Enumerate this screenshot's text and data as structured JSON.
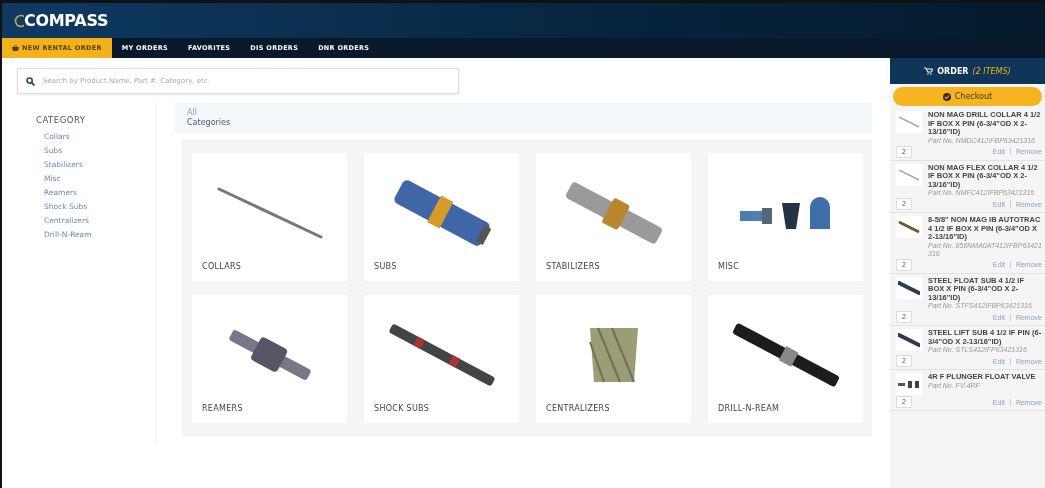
{
  "header": {
    "logo": "COMPASS"
  },
  "nav": [
    {
      "label": "NEW RENTAL ORDER",
      "selected": true
    },
    {
      "label": "MY ORDERS",
      "selected": false
    },
    {
      "label": "FAVORITES",
      "selected": false
    },
    {
      "label": "DIS ORDERS",
      "selected": false
    },
    {
      "label": "DNR ORDERS",
      "selected": false
    }
  ],
  "search": {
    "placeholder": "Search by Product Name, Part #, Category, etc."
  },
  "sidebar": {
    "title": "CATEGORY",
    "items": [
      "Collars",
      "Subs",
      "Stabilizers",
      "Misc",
      "Reamers",
      "Shock Subs",
      "Centralizers",
      "Drill-N-Ream"
    ]
  },
  "breadcrumb": [
    "All",
    "Categories"
  ],
  "categories": [
    {
      "name": "COLLARS",
      "kind": "collar"
    },
    {
      "name": "SUBS",
      "kind": "sub"
    },
    {
      "name": "STABILIZERS",
      "kind": "stabilizer"
    },
    {
      "name": "MISC",
      "kind": "misc"
    },
    {
      "name": "REAMERS",
      "kind": "reamer"
    },
    {
      "name": "SHOCK SUBS",
      "kind": "shock"
    },
    {
      "name": "CENTRALIZERS",
      "kind": "centralizer"
    },
    {
      "name": "DRILL-N-REAM",
      "kind": "drillream"
    }
  ],
  "order": {
    "title": "ORDER",
    "count": "(2 ITEMS)",
    "checkout": "Checkout",
    "items": [
      {
        "kind": "pipe-light",
        "name": "NON MAG DRILL COLLAR 4 1/2 IF BOX X PIN (6-3/4\"OD X 2-13/16\"ID)",
        "part": "Part No. NMDC412IFBP63421316",
        "qty": "2",
        "edit": "Edit",
        "remove": "Remove"
      },
      {
        "kind": "pipe-light",
        "name": "NON MAG FLEX COLLAR 4 1/2 IF BOX X PIN (6-3/4\"OD X 2-13/16\"ID)",
        "part": "Part No. NMFC412IFBP63421316",
        "qty": "2",
        "edit": "Edit",
        "remove": "Remove"
      },
      {
        "kind": "pipe-gold",
        "name": "8-5/8\" NON MAG IB AUTOTRAC 4 1/2 IF BOX X PIN (6-3/4\"OD X 2-13/16\"ID)",
        "part": "Part No. 858NMA0AT412IFBP63421316",
        "qty": "2",
        "edit": "Edit",
        "remove": "Remove"
      },
      {
        "kind": "pipe-dark",
        "name": "STEEL FLOAT SUB 4 1/2 IF BOX X PIN (6-3/4\"OD X 2-13/16\"ID)",
        "part": "Part No. STFS412IFBP63421316",
        "qty": "2",
        "edit": "Edit",
        "remove": "Remove"
      },
      {
        "kind": "pipe-dark",
        "name": "STEEL LIFT SUB 4 1/2 IF PIN (6-3/4\"OD X 2-13/16\"ID)",
        "part": "Part No. STLS412IFP63421316",
        "qty": "2",
        "edit": "Edit",
        "remove": "Remove"
      },
      {
        "kind": "valve",
        "name": "4R F PLUNGER FLOAT VALVE",
        "part": "Part No. FV-4RF",
        "qty": "2",
        "edit": "Edit",
        "remove": "Remove"
      }
    ]
  }
}
